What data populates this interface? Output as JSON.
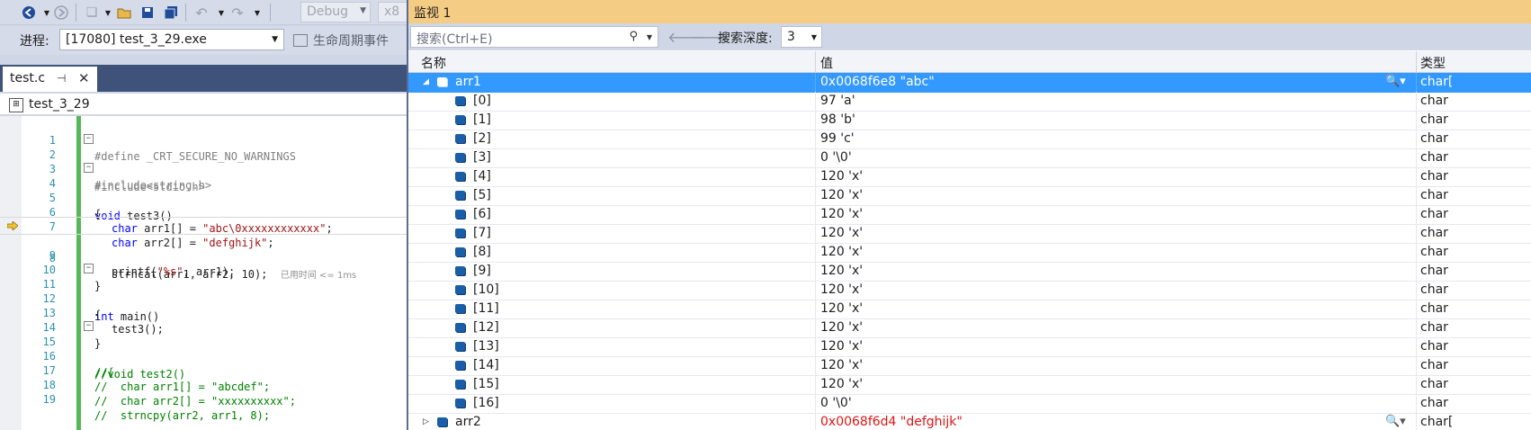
{
  "toolbar": {
    "config": "Debug",
    "platform": "x8",
    "process_label": "进程:",
    "process_value": "[17080] test_3_29.exe",
    "lifecycle_label": "生命周期事件"
  },
  "editor": {
    "tab_title": "test.c",
    "nav_scope": "test_3_29",
    "lines": [
      {
        "n": "1"
      },
      {
        "n": "2"
      },
      {
        "n": "3"
      },
      {
        "n": "4"
      },
      {
        "n": "5"
      },
      {
        "n": "6"
      },
      {
        "n": "7"
      },
      {
        "n": "8"
      },
      {
        "n": "9"
      },
      {
        "n": "10"
      },
      {
        "n": "11"
      },
      {
        "n": "12"
      },
      {
        "n": "13"
      },
      {
        "n": "14"
      },
      {
        "n": "15"
      },
      {
        "n": "16"
      },
      {
        "n": "17"
      },
      {
        "n": "18"
      },
      {
        "n": "19"
      }
    ],
    "code": {
      "l1": "#define _CRT_SECURE_NO_WARNINGS",
      "l2": "#include<stdio.h>",
      "l3": "#include<string.h>",
      "l4a": "void",
      "l4b": " test3()",
      "l5": "{",
      "l6a": "char",
      "l6b": " arr1[] = ",
      "l6c": "\"abc\\0xxxxxxxxxxxx\"",
      "l6d": ";",
      "l7a": "char",
      "l7b": " arr2[] = ",
      "l7c": "\"defghijk\"",
      "l7d": ";",
      "l8a": "strncat(arr1, arr2, 10);",
      "l8hint": "已用时间 <= 1ms",
      "l9a": "printf(",
      "l9b": "\"%s\"",
      "l9c": ", arr1);",
      "l10": "}",
      "l11a": "int",
      "l11b": " main()",
      "l12": "{",
      "l13": "test3();",
      "l14": "}",
      "l15": "//void test2()",
      "l16": "//{",
      "l17": "//  char arr1[] = \"abcdef\";",
      "l18": "//  char arr2[] = \"xxxxxxxxxx\";",
      "l19": "//  strncpy(arr2, arr1, 8);"
    }
  },
  "watch": {
    "title": "监视 1",
    "search_placeholder": "搜索(Ctrl+E)",
    "depth_label": "搜索深度:",
    "depth_value": "3",
    "columns": {
      "name": "名称",
      "value": "值",
      "type": "类型"
    },
    "rows": [
      {
        "name": "arr1",
        "value": "0x0068f6e8 \"abc\"",
        "type": "char["
      },
      {
        "name": "[0]",
        "value": "97 'a'",
        "type": "char"
      },
      {
        "name": "[1]",
        "value": "98 'b'",
        "type": "char"
      },
      {
        "name": "[2]",
        "value": "99 'c'",
        "type": "char"
      },
      {
        "name": "[3]",
        "value": "0 '\\0'",
        "type": "char"
      },
      {
        "name": "[4]",
        "value": "120 'x'",
        "type": "char"
      },
      {
        "name": "[5]",
        "value": "120 'x'",
        "type": "char"
      },
      {
        "name": "[6]",
        "value": "120 'x'",
        "type": "char"
      },
      {
        "name": "[7]",
        "value": "120 'x'",
        "type": "char"
      },
      {
        "name": "[8]",
        "value": "120 'x'",
        "type": "char"
      },
      {
        "name": "[9]",
        "value": "120 'x'",
        "type": "char"
      },
      {
        "name": "[10]",
        "value": "120 'x'",
        "type": "char"
      },
      {
        "name": "[11]",
        "value": "120 'x'",
        "type": "char"
      },
      {
        "name": "[12]",
        "value": "120 'x'",
        "type": "char"
      },
      {
        "name": "[13]",
        "value": "120 'x'",
        "type": "char"
      },
      {
        "name": "[14]",
        "value": "120 'x'",
        "type": "char"
      },
      {
        "name": "[15]",
        "value": "120 'x'",
        "type": "char"
      },
      {
        "name": "[16]",
        "value": "0 '\\0'",
        "type": "char"
      },
      {
        "name": "arr2",
        "value": "0x0068f6d4 \"defghijk\"",
        "type": "char["
      }
    ]
  },
  "colors": {
    "watch_title_bg": "#f5cc84",
    "selection": "#3399ff",
    "changed_value": "#e01414",
    "keyword": "#0000ff",
    "string": "#a31515",
    "comment": "#008000"
  }
}
